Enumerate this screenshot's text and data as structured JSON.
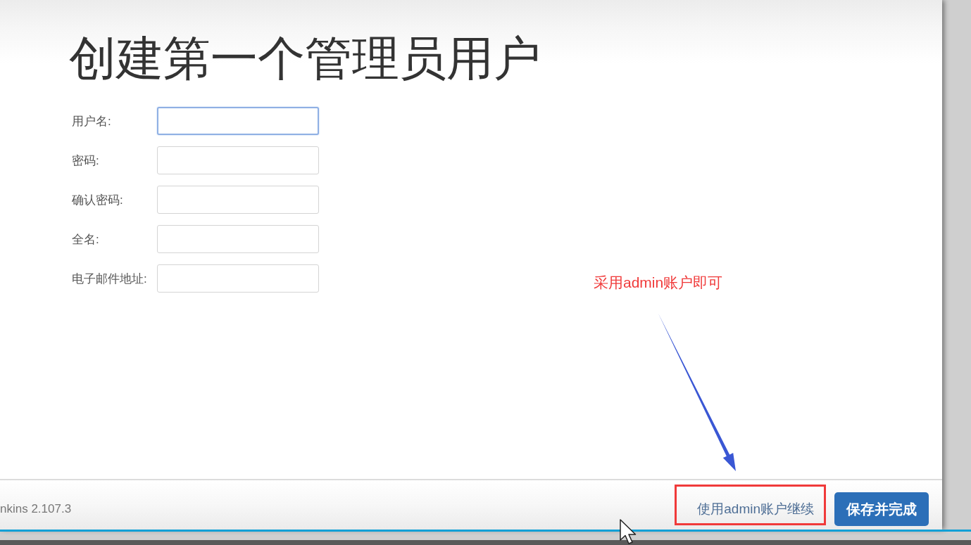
{
  "dialog": {
    "title": "创建第一个管理员用户",
    "fields": [
      {
        "label": "用户名:",
        "focused": true
      },
      {
        "label": "密码:",
        "focused": false
      },
      {
        "label": "确认密码:",
        "focused": false
      },
      {
        "label": "全名:",
        "focused": false
      },
      {
        "label": "电子邮件地址:",
        "focused": false
      }
    ],
    "footer": {
      "version": "nkins 2.107.3",
      "link": "使用admin账户继续",
      "button": "保存并完成"
    }
  },
  "annotation": {
    "note": "采用admin账户即可"
  }
}
